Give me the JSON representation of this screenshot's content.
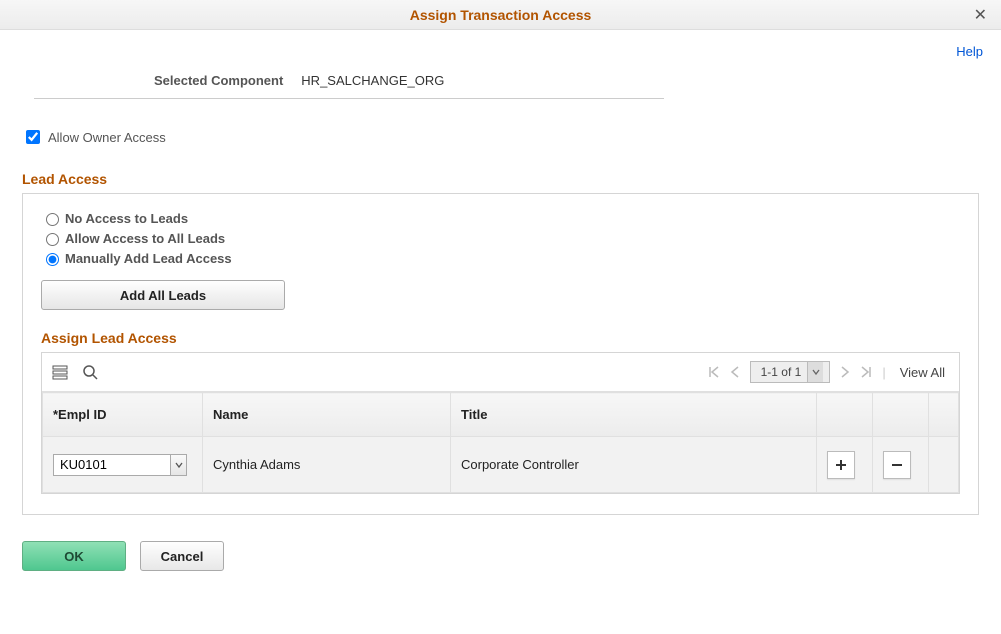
{
  "header": {
    "title": "Assign Transaction Access",
    "help_label": "Help"
  },
  "component": {
    "label": "Selected Component",
    "value": "HR_SALCHANGE_ORG"
  },
  "owner_access": {
    "label": "Allow Owner Access",
    "checked": true
  },
  "lead_access": {
    "heading": "Lead Access",
    "options": {
      "none": "No Access to Leads",
      "all": "Allow Access to All Leads",
      "manual": "Manually Add Lead Access"
    },
    "selected": "manual",
    "add_all_label": "Add All Leads"
  },
  "grid": {
    "heading": "Assign Lead Access",
    "pager_text": "1-1 of 1",
    "view_all_label": "View All",
    "columns": {
      "empl_id": "*Empl ID",
      "name": "Name",
      "title": "Title"
    },
    "rows": [
      {
        "empl_id": "KU0101",
        "name": "Cynthia Adams",
        "title": "Corporate Controller"
      }
    ]
  },
  "footer": {
    "ok": "OK",
    "cancel": "Cancel"
  }
}
